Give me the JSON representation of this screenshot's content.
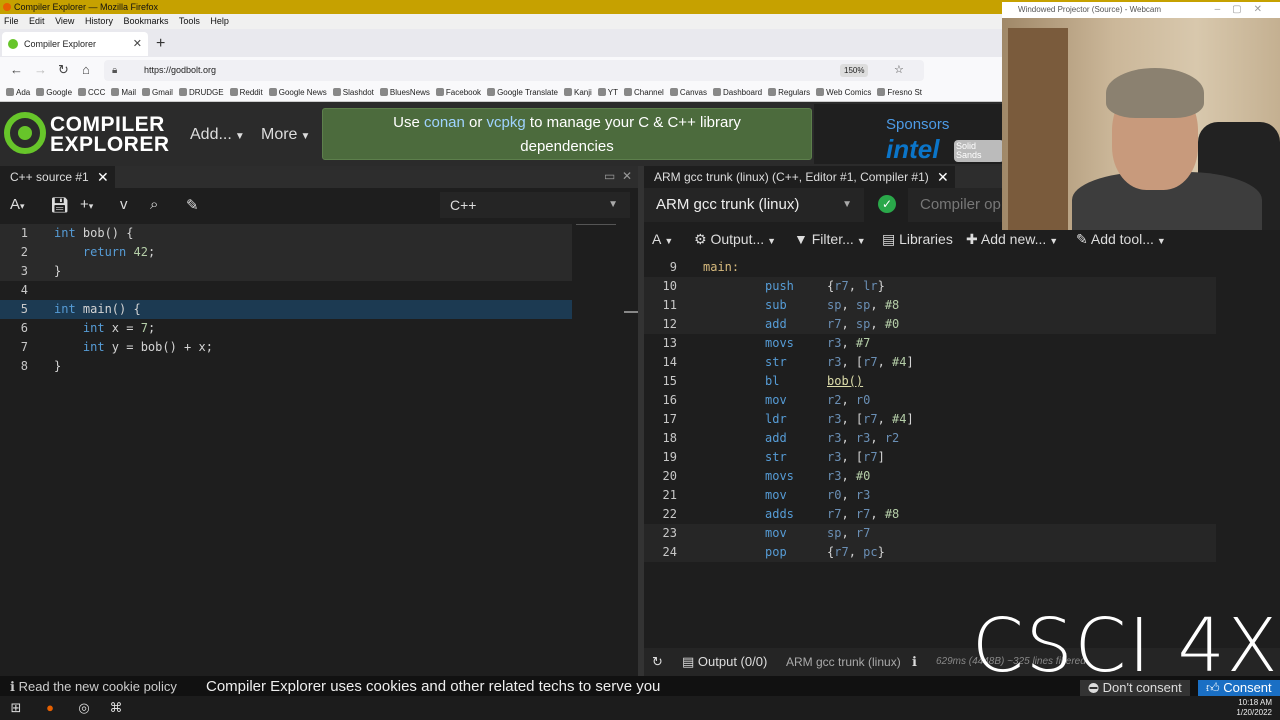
{
  "browser": {
    "window_title": "Compiler Explorer — Mozilla Firefox",
    "menu": [
      "File",
      "Edit",
      "View",
      "History",
      "Bookmarks",
      "Tools",
      "Help"
    ],
    "tab_title": "Compiler Explorer",
    "url": "https://godbolt.org",
    "zoom": "150%",
    "bookmarks": [
      "Ada",
      "Google",
      "CCC",
      "Mail",
      "Gmail",
      "DRUDGE",
      "Reddit",
      "Google News",
      "Slashdot",
      "BluesNews",
      "Facebook",
      "Google Translate",
      "Kanji",
      "YT",
      "Channel",
      "Canvas",
      "Dashboard",
      "Regulars",
      "Web Comics",
      "Fresno St"
    ]
  },
  "header": {
    "logo_line1": "COMPILER",
    "logo_line2": "EXPLORER",
    "add_menu": "Add...",
    "more_menu": "More",
    "banner_pre": "Use ",
    "banner_link1": "conan",
    "banner_mid": " or ",
    "banner_link2": "vcpkg",
    "banner_post": " to manage your C & C++ library",
    "banner_line2": "dependencies",
    "sponsors_title": "Sponsors",
    "sponsor_intel": "intel",
    "sponsor_solid": "Solid Sands"
  },
  "source_pane": {
    "tab_title": "C++ source #1",
    "language": "C++",
    "lines": [
      {
        "n": "1",
        "parts": [
          [
            "kw",
            "int"
          ],
          [
            "t",
            " bob() {"
          ]
        ]
      },
      {
        "n": "2",
        "parts": [
          [
            "kw",
            "    return"
          ],
          [
            "t",
            " "
          ],
          [
            "num",
            "42"
          ],
          [
            "t",
            ";"
          ]
        ]
      },
      {
        "n": "3",
        "parts": [
          [
            "t",
            "}"
          ]
        ]
      },
      {
        "n": "4",
        "parts": [
          [
            "t",
            ""
          ]
        ]
      },
      {
        "n": "5",
        "parts": [
          [
            "kw",
            "int"
          ],
          [
            "t",
            " main() {"
          ]
        ]
      },
      {
        "n": "6",
        "parts": [
          [
            "kw",
            "    int"
          ],
          [
            "t",
            " x = "
          ],
          [
            "num",
            "7"
          ],
          [
            "t",
            ";"
          ]
        ]
      },
      {
        "n": "7",
        "parts": [
          [
            "kw",
            "    int"
          ],
          [
            "t",
            " y = bob() + x;"
          ]
        ]
      },
      {
        "n": "8",
        "parts": [
          [
            "t",
            "}"
          ]
        ]
      }
    ]
  },
  "compiler_pane": {
    "tab_title": "ARM gcc trunk (linux) (C++, Editor #1, Compiler #1)",
    "compiler": "ARM gcc trunk (linux)",
    "options_placeholder": "Compiler op",
    "toolbar": {
      "output": "Output...",
      "filter": "Filter...",
      "libraries": "Libraries",
      "add_new": "Add new...",
      "add_tool": "Add tool..."
    },
    "asm": [
      {
        "n": "9",
        "label": "main:",
        "op": "",
        "args": []
      },
      {
        "n": "10",
        "label": "",
        "op": "push",
        "args": [
          [
            "pun",
            "{"
          ],
          [
            "reg",
            "r7"
          ],
          [
            "pun",
            ", "
          ],
          [
            "reg",
            "lr"
          ],
          [
            "pun",
            "}"
          ]
        ]
      },
      {
        "n": "11",
        "label": "",
        "op": "sub",
        "args": [
          [
            "reg",
            "sp"
          ],
          [
            "pun",
            ", "
          ],
          [
            "reg",
            "sp"
          ],
          [
            "pun",
            ", "
          ],
          [
            "imm",
            "#8"
          ]
        ]
      },
      {
        "n": "12",
        "label": "",
        "op": "add",
        "args": [
          [
            "reg",
            "r7"
          ],
          [
            "pun",
            ", "
          ],
          [
            "reg",
            "sp"
          ],
          [
            "pun",
            ", "
          ],
          [
            "imm",
            "#0"
          ]
        ]
      },
      {
        "n": "13",
        "label": "",
        "op": "movs",
        "args": [
          [
            "reg",
            "r3"
          ],
          [
            "pun",
            ", "
          ],
          [
            "imm",
            "#7"
          ]
        ]
      },
      {
        "n": "14",
        "label": "",
        "op": "str",
        "args": [
          [
            "reg",
            "r3"
          ],
          [
            "pun",
            ", ["
          ],
          [
            "reg",
            "r7"
          ],
          [
            "pun",
            ", "
          ],
          [
            "imm",
            "#4"
          ],
          [
            "pun",
            "]"
          ]
        ]
      },
      {
        "n": "15",
        "label": "",
        "op": "bl",
        "args": [
          [
            "fn",
            "bob()"
          ]
        ]
      },
      {
        "n": "16",
        "label": "",
        "op": "mov",
        "args": [
          [
            "reg",
            "r2"
          ],
          [
            "pun",
            ", "
          ],
          [
            "reg",
            "r0"
          ]
        ]
      },
      {
        "n": "17",
        "label": "",
        "op": "ldr",
        "args": [
          [
            "reg",
            "r3"
          ],
          [
            "pun",
            ", ["
          ],
          [
            "reg",
            "r7"
          ],
          [
            "pun",
            ", "
          ],
          [
            "imm",
            "#4"
          ],
          [
            "pun",
            "]"
          ]
        ]
      },
      {
        "n": "18",
        "label": "",
        "op": "add",
        "args": [
          [
            "reg",
            "r3"
          ],
          [
            "pun",
            ", "
          ],
          [
            "reg",
            "r3"
          ],
          [
            "pun",
            ", "
          ],
          [
            "reg",
            "r2"
          ]
        ]
      },
      {
        "n": "19",
        "label": "",
        "op": "str",
        "args": [
          [
            "reg",
            "r3"
          ],
          [
            "pun",
            ", ["
          ],
          [
            "reg",
            "r7"
          ],
          [
            "pun",
            "]"
          ]
        ]
      },
      {
        "n": "20",
        "label": "",
        "op": "movs",
        "args": [
          [
            "reg",
            "r3"
          ],
          [
            "pun",
            ", "
          ],
          [
            "imm",
            "#0"
          ]
        ]
      },
      {
        "n": "21",
        "label": "",
        "op": "mov",
        "args": [
          [
            "reg",
            "r0"
          ],
          [
            "pun",
            ", "
          ],
          [
            "reg",
            "r3"
          ]
        ]
      },
      {
        "n": "22",
        "label": "",
        "op": "adds",
        "args": [
          [
            "reg",
            "r7"
          ],
          [
            "pun",
            ", "
          ],
          [
            "reg",
            "r7"
          ],
          [
            "pun",
            ", "
          ],
          [
            "imm",
            "#8"
          ]
        ]
      },
      {
        "n": "23",
        "label": "",
        "op": "mov",
        "args": [
          [
            "reg",
            "sp"
          ],
          [
            "pun",
            ", "
          ],
          [
            "reg",
            "r7"
          ]
        ]
      },
      {
        "n": "24",
        "label": "",
        "op": "pop",
        "args": [
          [
            "pun",
            "{"
          ],
          [
            "reg",
            "r7"
          ],
          [
            "pun",
            ", "
          ],
          [
            "reg",
            "pc"
          ],
          [
            "pun",
            "}"
          ]
        ]
      }
    ],
    "status": {
      "output": "Output (0/0)",
      "compiler": "ARM gcc trunk (linux)",
      "timing": "629ms (4448B) ~325 lines filtered"
    }
  },
  "cookie_bar": {
    "small": "Read the new cookie policy",
    "main": "Compiler Explorer uses cookies and other related techs to serve you",
    "dont": "Don't consent",
    "consent": "Consent"
  },
  "taskbar": {
    "time": "10:18 AM",
    "date": "1/20/2022"
  },
  "webcam": {
    "title": "Windowed Projector (Source) - Webcam"
  },
  "brand": "CSCI 4X"
}
